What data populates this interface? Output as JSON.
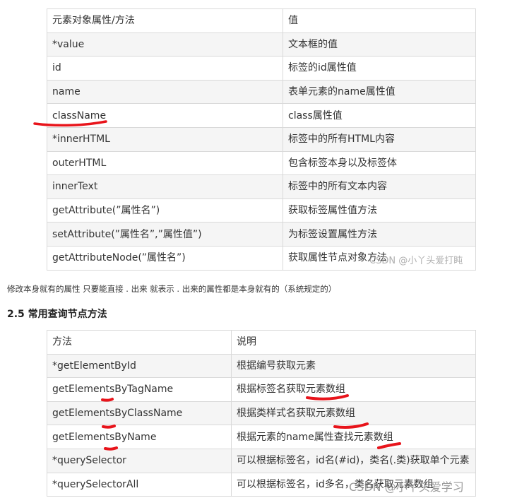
{
  "properties_table": {
    "rows": [
      [
        "元素对象属性/方法",
        "值"
      ],
      [
        "*value",
        "文本框的值"
      ],
      [
        "id",
        "标签的id属性值"
      ],
      [
        "name",
        "表单元素的name属性值"
      ],
      [
        "className",
        "class属性值"
      ],
      [
        "*innerHTML",
        "标签中的所有HTML内容"
      ],
      [
        "outerHTML",
        "包含标签本身以及标签体"
      ],
      [
        "innerText",
        "标签中的所有文本内容"
      ],
      [
        "getAttribute(”属性名”)",
        "获取标签属性值方法"
      ],
      [
        "setAttribute(”属性名”,”属性值”)",
        "为标签设置属性方法"
      ],
      [
        "getAttributeNode(”属性名”)",
        "获取属性节点对象方法"
      ]
    ]
  },
  "note": "修改本身就有的属性 只要能直接 . 出来 就表示 . 出来的属性都是本身就有的（系统规定的）",
  "section_heading": "2.5 常用查询节点方法",
  "query_table": {
    "rows": [
      [
        "方法",
        "说明"
      ],
      [
        "*getElementById",
        "根据编号获取元素"
      ],
      [
        "getElementsByTagName",
        "根据标签名获取元素数组"
      ],
      [
        "getElementsByClassName",
        "根据类样式名获取元素数组"
      ],
      [
        "getElementsByName",
        "根据元素的name属性查找元素数组"
      ],
      [
        "*querySelector",
        "可以根据标签名，id名(#id)，类名(.类)获取单个元素"
      ],
      [
        "*querySelectorAll",
        "可以根据标签名，id多名，类名获取元素数组"
      ]
    ]
  },
  "watermarks": {
    "first": "CSDN @小丫头爱打盹",
    "second": "CSDN @小丫头爱学习"
  },
  "colors": {
    "annotation": "#e8141b",
    "border": "#d9d9d9",
    "stripe": "#f5f5f5"
  }
}
